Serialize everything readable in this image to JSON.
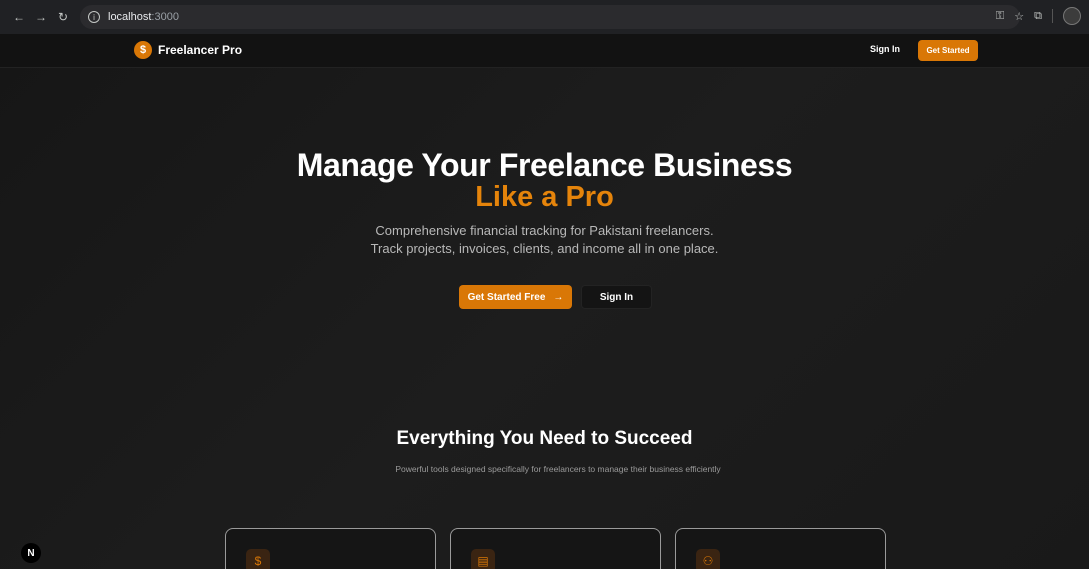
{
  "browser": {
    "url_host": "localhost",
    "url_port": ":3000"
  },
  "nav": {
    "brand_icon": "$",
    "brand_name": "Freelancer Pro",
    "signin": "Sign In",
    "get_started": "Get Started"
  },
  "hero": {
    "title_line1": "Manage Your Freelance Business",
    "title_line2": "Like a Pro",
    "subtitle_line1": "Comprehensive financial tracking for Pakistani freelancers.",
    "subtitle_line2": "Track projects, invoices, clients, and income all in one place.",
    "primary_button": "Get Started Free",
    "primary_arrow": "→",
    "secondary_button": "Sign In"
  },
  "features": {
    "title": "Everything You Need to Succeed",
    "subtitle": "Powerful tools designed specifically for freelancers to manage their business efficiently",
    "cards": [
      {
        "icon": "dollar-icon",
        "glyph": "$"
      },
      {
        "icon": "document-icon",
        "glyph": "▤"
      },
      {
        "icon": "users-icon",
        "glyph": "⚇"
      }
    ]
  },
  "dev_badge": "N",
  "colors": {
    "accent": "#d97706",
    "background": "#181818"
  }
}
